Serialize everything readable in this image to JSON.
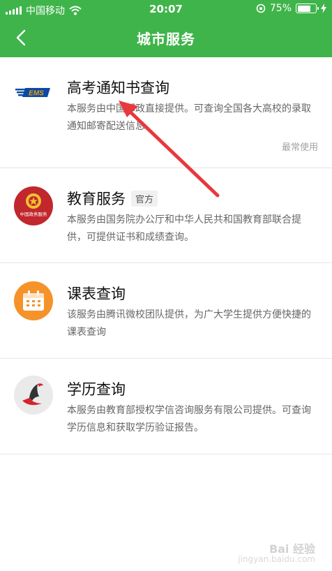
{
  "status_bar": {
    "carrier": "中国移动",
    "time": "20:07",
    "battery_percent": "75%",
    "battery_level": 0.75
  },
  "nav": {
    "title": "城市服务",
    "back_icon": "chevron-left-icon",
    "color": "#3fb44a"
  },
  "services": [
    {
      "name": "高考通知书查询",
      "logo": "ems-logo",
      "logo_text": "EMS",
      "description": "本服务由中国邮政直接提供。可查询全国各大高校的录取通知邮寄配送信息。",
      "frequency": "最常使用"
    },
    {
      "name": "教育服务",
      "tag": "官方",
      "logo": "government-emblem-icon",
      "logo_text": "中国政务服务",
      "description": "本服务由国务院办公厅和中华人民共和国教育部联合提供，可提供证书和成绩查询。"
    },
    {
      "name": "课表查询",
      "logo": "calendar-icon",
      "description": "该服务由腾讯微校团队提供，为广大学生提供方便快捷的课表查询"
    },
    {
      "name": "学历查询",
      "logo": "chsi-logo",
      "description": "本服务由教育部授权学信咨询服务有限公司提供。可查询学历信息和获取学历验证报告。"
    }
  ],
  "watermark": {
    "line1": "Bai 经验",
    "line2": "jingyan.baidu.com"
  }
}
